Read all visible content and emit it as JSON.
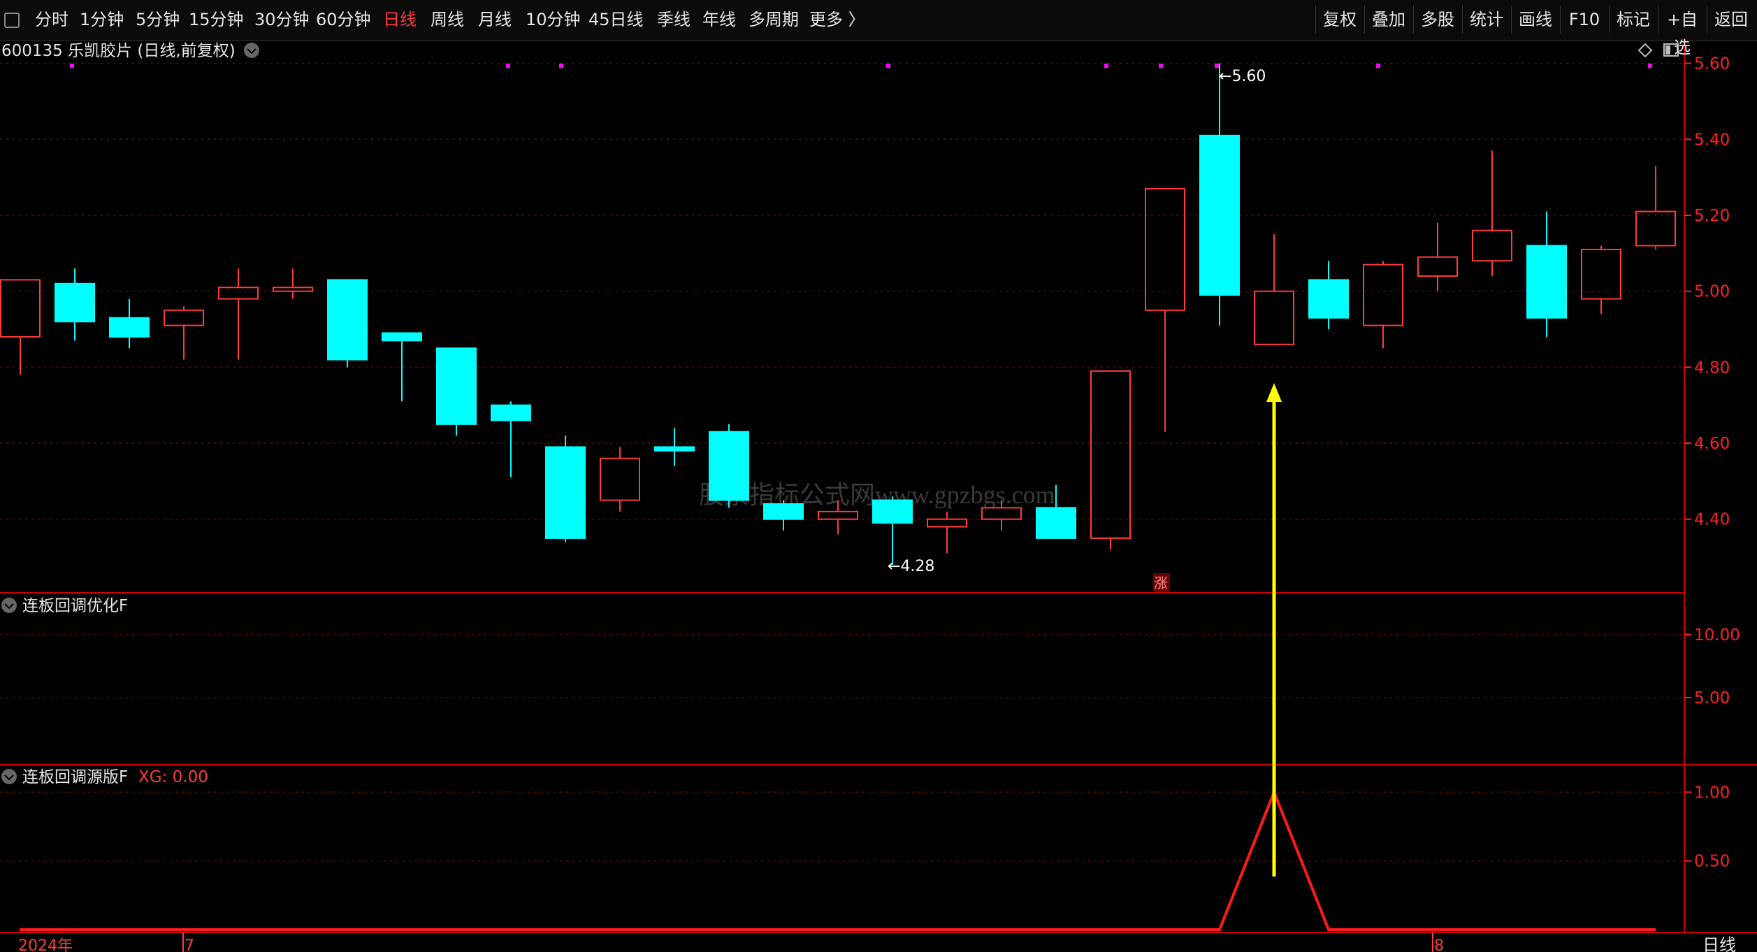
{
  "toolbar": {
    "periods": [
      "分时",
      "1分钟",
      "5分钟",
      "15分钟",
      "30分钟",
      "60分钟",
      "日线",
      "周线",
      "月线",
      "10分钟",
      "45日线",
      "季线",
      "年线",
      "多周期",
      "更多 〉"
    ],
    "active_period": "日线",
    "right_buttons": [
      "复权",
      "叠加",
      "多股",
      "统计",
      "画线",
      "F10",
      "标记",
      "+自选",
      "返回"
    ]
  },
  "main_panel": {
    "title": "600135 乐凯胶片 (日线,前复权)",
    "watermark": "股票指标公式网www.gpzbgs.com",
    "max_label": "5.60",
    "min_label": "4.28",
    "limit_up_mark": "涨"
  },
  "panel2": {
    "title": "连板回调优化F",
    "y_ticks": [
      "10.00",
      "5.00"
    ]
  },
  "panel3": {
    "title": "连板回调源版F",
    "xg_label": "XG: 0.00",
    "y_ticks": [
      "1.00",
      "0.50"
    ]
  },
  "x_axis": {
    "labels": [
      "2024年",
      "7",
      "8"
    ],
    "period_label": "日线"
  },
  "colors": {
    "up": "#ff3b3b",
    "down": "#00ffff",
    "grid": "#7a0000",
    "axis": "#ff2020",
    "arrow": "#ffff00",
    "dot": "#ff00ff"
  },
  "chart_data": [
    {
      "type": "candlestick",
      "y_axis_ticks": [
        5.6,
        5.4,
        5.2,
        5.0,
        4.8,
        4.6,
        4.4
      ],
      "ylim": [
        4.21,
        5.66
      ],
      "candles": [
        {
          "o": 4.88,
          "h": 5.03,
          "l": 4.78,
          "c": 5.03
        },
        {
          "o": 5.02,
          "h": 5.06,
          "l": 4.87,
          "c": 4.92
        },
        {
          "o": 4.93,
          "h": 4.98,
          "l": 4.85,
          "c": 4.88
        },
        {
          "o": 4.91,
          "h": 4.96,
          "l": 4.82,
          "c": 4.95
        },
        {
          "o": 4.98,
          "h": 5.06,
          "l": 4.82,
          "c": 5.01
        },
        {
          "o": 5.0,
          "h": 5.06,
          "l": 4.98,
          "c": 5.01
        },
        {
          "o": 5.03,
          "h": 5.03,
          "l": 4.8,
          "c": 4.82
        },
        {
          "o": 4.89,
          "h": 4.89,
          "l": 4.71,
          "c": 4.87
        },
        {
          "o": 4.85,
          "h": 4.85,
          "l": 4.62,
          "c": 4.65
        },
        {
          "o": 4.7,
          "h": 4.71,
          "l": 4.51,
          "c": 4.66
        },
        {
          "o": 4.59,
          "h": 4.62,
          "l": 4.34,
          "c": 4.35
        },
        {
          "o": 4.45,
          "h": 4.59,
          "l": 4.42,
          "c": 4.56
        },
        {
          "o": 4.59,
          "h": 4.64,
          "l": 4.54,
          "c": 4.58
        },
        {
          "o": 4.63,
          "h": 4.65,
          "l": 4.43,
          "c": 4.45
        },
        {
          "o": 4.44,
          "h": 4.45,
          "l": 4.37,
          "c": 4.4
        },
        {
          "o": 4.4,
          "h": 4.45,
          "l": 4.36,
          "c": 4.42
        },
        {
          "o": 4.45,
          "h": 4.46,
          "l": 4.28,
          "c": 4.39
        },
        {
          "o": 4.38,
          "h": 4.42,
          "l": 4.31,
          "c": 4.4
        },
        {
          "o": 4.4,
          "h": 4.45,
          "l": 4.37,
          "c": 4.43
        },
        {
          "o": 4.43,
          "h": 4.49,
          "l": 4.35,
          "c": 4.35
        },
        {
          "o": 4.35,
          "h": 4.79,
          "l": 4.32,
          "c": 4.79
        },
        {
          "o": 4.95,
          "h": 5.27,
          "l": 4.63,
          "c": 5.27
        },
        {
          "o": 5.41,
          "h": 5.6,
          "l": 4.91,
          "c": 4.99
        },
        {
          "o": 4.86,
          "h": 5.15,
          "l": 4.86,
          "c": 5.0
        },
        {
          "o": 5.03,
          "h": 5.08,
          "l": 4.9,
          "c": 4.93
        },
        {
          "o": 4.91,
          "h": 5.08,
          "l": 4.85,
          "c": 5.07
        },
        {
          "o": 5.04,
          "h": 5.18,
          "l": 5.0,
          "c": 5.09
        },
        {
          "o": 5.08,
          "h": 5.37,
          "l": 5.04,
          "c": 5.16
        },
        {
          "o": 5.12,
          "h": 5.21,
          "l": 4.88,
          "c": 4.93
        },
        {
          "o": 4.98,
          "h": 5.12,
          "l": 4.94,
          "c": 5.11
        },
        {
          "o": 5.12,
          "h": 5.33,
          "l": 5.11,
          "c": 5.21
        }
      ]
    },
    {
      "type": "line",
      "name": "连板回调源版F",
      "ylim": [
        0,
        1.2
      ],
      "y_ticks": [
        1.0,
        0.5
      ],
      "x": [
        0,
        1,
        2,
        3,
        4,
        5,
        6,
        7,
        8,
        9,
        10,
        11,
        12,
        13,
        14,
        15,
        16,
        17,
        18,
        19,
        20,
        21,
        22,
        23,
        24,
        25,
        26,
        27,
        28,
        29,
        30
      ],
      "values": [
        0,
        0,
        0,
        0,
        0,
        0,
        0,
        0,
        0,
        0,
        0,
        0,
        0,
        0,
        0,
        0,
        0,
        0,
        0,
        0,
        0,
        0,
        0,
        1,
        0,
        0,
        0,
        0,
        0,
        0,
        0
      ]
    }
  ]
}
